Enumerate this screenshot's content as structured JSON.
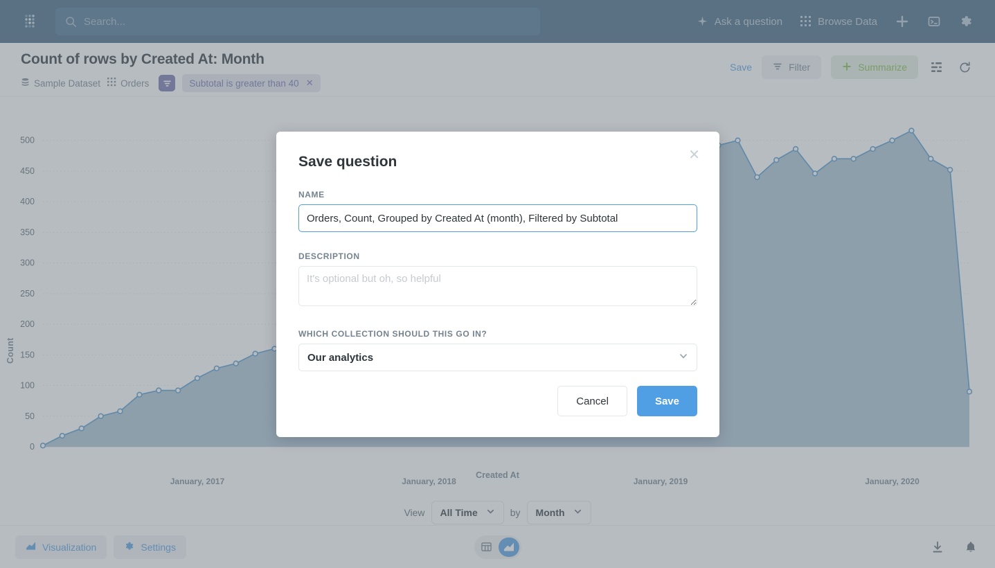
{
  "navbar": {
    "logo_icon": "metabase-dots-logo",
    "search": {
      "placeholder": "Search...",
      "icon": "search-icon"
    },
    "items": [
      {
        "label": "Ask a question",
        "icon": "sparkle-icon"
      },
      {
        "label": "Browse Data",
        "icon": "grid-icon"
      }
    ],
    "actions": [
      {
        "icon": "plus-icon"
      },
      {
        "icon": "console-icon"
      },
      {
        "icon": "gear-icon"
      }
    ],
    "bg_color": "#3d6280"
  },
  "question_header": {
    "title": "Count of rows by Created At: Month",
    "database": {
      "label": "Sample Dataset",
      "icon": "database-icon"
    },
    "table": {
      "label": "Orders",
      "icon": "table-icon"
    },
    "filter_icon": "filter-icon",
    "filter_pill": {
      "label": "Subtotal is greater than 40",
      "remove_icon": "close-icon"
    },
    "save_label": "Save",
    "filter_label": "Filter",
    "summarize_label": "Summarize",
    "row_icon": "row-chart-icon",
    "refresh_icon": "refresh-icon",
    "accent_save": "#509ee3",
    "accent_summarize": "#84bb4c",
    "accent_filter_pill": "#7172ad"
  },
  "chart_data": {
    "type": "area",
    "title": "Count of rows by Created At: Month",
    "xlabel": "Created At",
    "ylabel": "Count",
    "ylim": [
      0,
      520
    ],
    "yticks": [
      0,
      50,
      100,
      150,
      200,
      250,
      300,
      350,
      400,
      450,
      500
    ],
    "xticks": [
      "January, 2017",
      "January, 2018",
      "January, 2019",
      "January, 2020"
    ],
    "grid": true,
    "line_color": "#509ee3",
    "area_color": "#a0bdd4",
    "series": [
      {
        "name": "Count",
        "x": [
          "2016-05",
          "2016-06",
          "2016-07",
          "2016-08",
          "2016-09",
          "2016-10",
          "2016-11",
          "2016-12",
          "2017-01",
          "2017-02",
          "2017-03",
          "2017-04",
          "2017-05",
          "2017-06",
          "2017-07",
          "2017-08",
          "2017-09",
          "2017-10",
          "2017-11",
          "2017-12",
          "2018-01",
          "2018-02",
          "2018-03",
          "2018-04",
          "2018-05",
          "2018-06",
          "2018-07",
          "2018-08",
          "2018-09",
          "2018-10",
          "2018-11",
          "2018-12",
          "2019-01",
          "2019-02",
          "2019-03",
          "2019-04",
          "2019-05",
          "2019-06",
          "2019-07",
          "2019-08",
          "2019-09",
          "2019-10",
          "2019-11",
          "2019-12",
          "2020-01",
          "2020-02",
          "2020-03",
          "2020-04"
        ],
        "values": [
          2,
          18,
          30,
          50,
          58,
          85,
          92,
          92,
          112,
          128,
          136,
          152,
          160,
          164,
          178,
          152,
          200,
          230,
          258,
          276,
          300,
          318,
          340,
          352,
          368,
          382,
          396,
          410,
          424,
          438,
          452,
          466,
          470,
          508,
          452,
          492,
          500,
          440,
          468,
          486,
          446,
          470,
          470,
          486,
          500,
          516,
          470,
          452,
          90
        ]
      }
    ]
  },
  "view_bar": {
    "view_label": "View",
    "time_value": "All Time",
    "by_label": "by",
    "unit_value": "Month",
    "chevron_icon": "chevron-down-icon"
  },
  "footer": {
    "visualization_label": "Visualization",
    "visualization_icon": "area-chart-icon",
    "settings_label": "Settings",
    "settings_icon": "gear-icon",
    "toggle": [
      {
        "icon": "table-icon",
        "active": false
      },
      {
        "icon": "area-chart-icon",
        "active": true
      }
    ],
    "download_icon": "download-icon",
    "alert_icon": "bell-icon"
  },
  "modal": {
    "title": "Save question",
    "close_icon": "close-icon",
    "name_label": "NAME",
    "name_value": "Orders, Count, Grouped by Created At (month), Filtered by Subtotal",
    "description_label": "DESCRIPTION",
    "description_value": "",
    "description_placeholder": "It's optional but oh, so helpful",
    "collection_label": "WHICH COLLECTION SHOULD THIS GO IN?",
    "collection_value": "Our analytics",
    "collection_chevron_icon": "chevron-down-icon",
    "cancel_label": "Cancel",
    "save_label": "Save",
    "save_color": "#509ee3"
  }
}
